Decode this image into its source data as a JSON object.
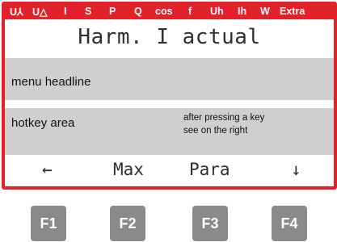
{
  "status_bar": {
    "items": [
      "U⅄",
      "U△",
      "I",
      "S",
      "P",
      "Q",
      "cos",
      "f",
      "Uh",
      "Ih",
      "W",
      "Extra"
    ]
  },
  "display": {
    "headline": "Harm. I actual",
    "menu_headline_label": "menu headline",
    "hotkey_area_label": "hotkey area",
    "note_line1": "after pressing a key",
    "note_line2": "see on the right",
    "hotkeys": [
      "←",
      "Max",
      "Para",
      "↓"
    ]
  },
  "function_keys": [
    "F1",
    "F2",
    "F3",
    "F4"
  ],
  "colors": {
    "frame": "#e2222a",
    "band": "#cfcfcf",
    "key": "#8a8a8a"
  }
}
